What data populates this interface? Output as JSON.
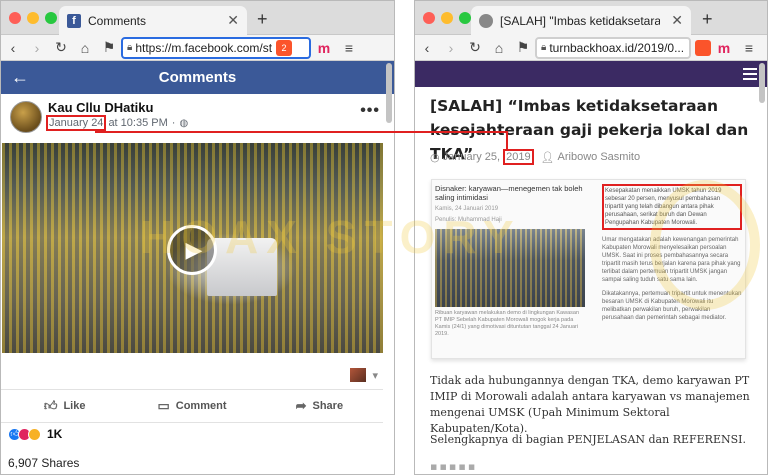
{
  "left_window": {
    "tab_title": "Comments",
    "url": "https://m.facebook.com/st",
    "shield_count": "2",
    "page_header": "Comments",
    "post": {
      "author": "Kau Cllu DHatiku",
      "date_highlight": "January 24",
      "date_rest": "at 10:35 PM",
      "date_sep": "·",
      "more": "•••"
    },
    "actions": {
      "like": "Like",
      "comment": "Comment",
      "share": "Share"
    },
    "reactions_count": "1K",
    "shares": "6,907 Shares"
  },
  "right_window": {
    "tab_title": "[SALAH] \"Imbas ketidaksetaraan k",
    "url": "turnbackhoax.id/2019/0...",
    "article": {
      "title": "[SALAH] “Imbas ketidaksetaraan kesejahteraan gaji pekerja lokal dan TKA”",
      "date_prefix": "January 25,",
      "date_year": "2019",
      "author": "Aribowo Sasmito",
      "clip_headline": "Disnaker: karyawan—menegemen tak boleh saling intimidasi",
      "clip_sub": "Kamis, 24 Januari 2019",
      "clip_author": "Penulis: Muhammad Haji",
      "clip_caption": "Ribuan karyawan melakukan demo di lingkungan Kawasan PT IMIP Sebelah Kabupaten Morowali mogok kerja pada Kamis (24/1) yang dimotivasi dituntutan tanggal 24 Januari 2019.",
      "clip_p1": "Kesepakatan menaikkan UMSK tahun 2019 sebesar 20 persen, menyusul pembahasan tripartit yang telah dibangun antara pihak perusahaan, serikat buruh dan Dewan Pengupahan Kabupaten Morowali.",
      "clip_p2": "Umar mengatakan adalah kewenangan pemerintah Kabupaten Morowali menyelesaikan persoalan UMSK. Saat ini proses pembahasannya secara tripartit masih terus berjalan karena para pihak yang terlibat dalam pertemuan tripartit UMSK jangan sampai saling tuduh satu sama lain.",
      "clip_p3": "Dikatakannya, pertemuan tripartit untuk menentukan besaran UMSK di Kabupaten Morowali itu melibatkan perwakilan buruh, perwakilan perusahaan dan pemerintah sebagai mediator.",
      "body1": "Tidak ada hubungannya dengan TKA, demo karyawan PT IMIP di Morowali adalah antara karyawan vs manajemen mengenai UMSK (Upah Minimum Sektoral Kabupaten/Kota).",
      "body2": "Selengkapnya di bagian PENJELASAN dan REFERENSI."
    }
  },
  "watermark_text": "HOAX STORY",
  "colors": {
    "facebook_blue": "#3b5998",
    "site_header": "#3b2a63",
    "highlight_red": "#e02020"
  }
}
